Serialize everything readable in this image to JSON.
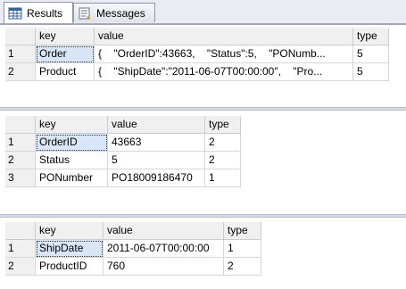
{
  "tabs": [
    {
      "label": "Results",
      "icon": "grid-icon",
      "active": true
    },
    {
      "label": "Messages",
      "icon": "messages-icon",
      "active": false
    }
  ],
  "grids": [
    {
      "headers": [
        "key",
        "value",
        "type"
      ],
      "rows": [
        {
          "num": "1",
          "cells": [
            "Order",
            "{    \"OrderID\":43663,    \"Status\":5,    \"PONumb...",
            "5"
          ]
        },
        {
          "num": "2",
          "cells": [
            "Product",
            "{    \"ShipDate\":\"2011-06-07T00:00:00\",    \"Pro...",
            "5"
          ]
        }
      ]
    },
    {
      "headers": [
        "key",
        "value",
        "type"
      ],
      "rows": [
        {
          "num": "1",
          "cells": [
            "OrderID",
            "43663",
            "2"
          ]
        },
        {
          "num": "2",
          "cells": [
            "Status",
            "5",
            "2"
          ]
        },
        {
          "num": "3",
          "cells": [
            "PONumber",
            "PO18009186470",
            "1"
          ]
        }
      ]
    },
    {
      "headers": [
        "key",
        "value",
        "type"
      ],
      "rows": [
        {
          "num": "1",
          "cells": [
            "ShipDate",
            "2011-06-07T00:00:00",
            "1"
          ]
        },
        {
          "num": "2",
          "cells": [
            "ProductID",
            "760",
            "2"
          ]
        }
      ]
    }
  ],
  "colors": {
    "selected_cell": "#d9e6f7",
    "header_bg": "#f0f0f0",
    "tab_bg": "#e9ecf2"
  }
}
